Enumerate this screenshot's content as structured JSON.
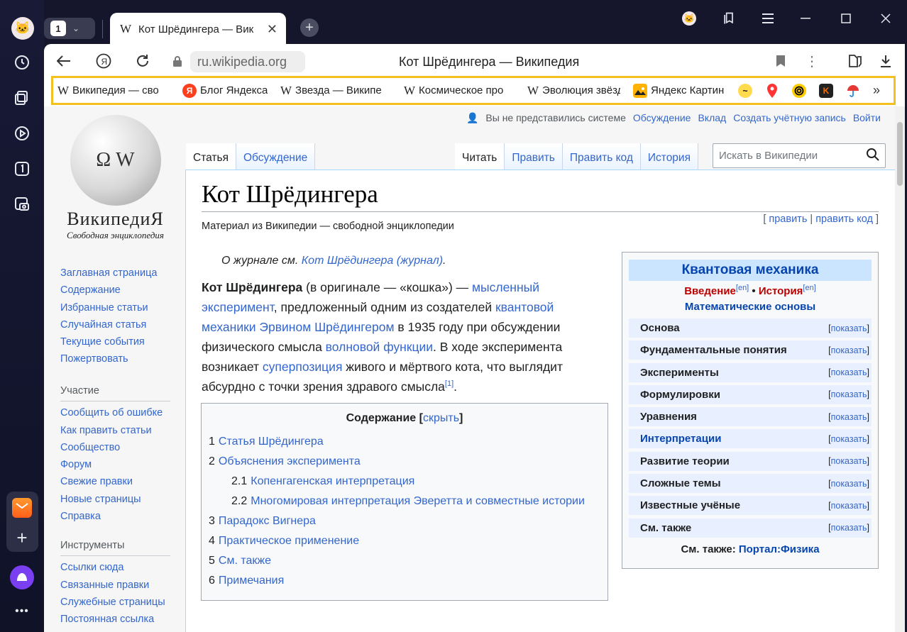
{
  "browser": {
    "tab_count": "1",
    "tab_title": "Кот Шрёдингера — Вик",
    "address": "ru.wikipedia.org",
    "page_title": "Кот Шрёдингера — Википедия",
    "bookmarks": [
      {
        "icon": "W",
        "label": "Википедия — сво"
      },
      {
        "icon": "Я",
        "label": "Блог Яндекса"
      },
      {
        "icon": "W",
        "label": "Звезда — Википе"
      },
      {
        "icon": "W",
        "label": "Космическое про"
      },
      {
        "icon": "W",
        "label": "Эволюция звёзд -"
      },
      {
        "icon": "img",
        "label": "Яндекс Картин"
      }
    ]
  },
  "wiki": {
    "personal": [
      "Вы не представились системе",
      "Обсуждение",
      "Вклад",
      "Создать учётную запись",
      "Войти"
    ],
    "logo_title": "ВикипедиЯ",
    "logo_sub": "Свободная энциклопедия",
    "nav_main": [
      "Заглавная страница",
      "Содержание",
      "Избранные статьи",
      "Случайная статья",
      "Текущие события",
      "Пожертвовать"
    ],
    "nav_part_title": "Участие",
    "nav_part": [
      "Сообщить об ошибке",
      "Как править статьи",
      "Сообщество",
      "Форум",
      "Свежие правки",
      "Новые страницы",
      "Справка"
    ],
    "nav_tools_title": "Инструменты",
    "nav_tools": [
      "Ссылки сюда",
      "Связанные правки",
      "Служебные страницы",
      "Постоянная ссылка"
    ],
    "tabs_left": [
      "Статья",
      "Обсуждение"
    ],
    "tabs_right": [
      "Читать",
      "Править",
      "Править код",
      "История"
    ],
    "search_placeholder": "Искать в Википедии",
    "title": "Кот Шрёдингера",
    "site_sub": "Материал из Википедии — свободной энциклопедии",
    "edit": "править",
    "edit_code": "править код",
    "hatnote_prefix": "О журнале см. ",
    "hatnote_link": "Кот Шрёдингера (журнал)",
    "lead": {
      "bold": "Кот Шрёдингера",
      "t1": " (в оригинале — «кошка») — ",
      "l1": "мысленный эксперимент",
      "t2": ", предложенный одним из создателей ",
      "l2": "квантовой механики",
      "t3": " ",
      "l3": "Эрвином Шрёдингером",
      "t4": " в 1935 году при обсуждении физического смысла ",
      "l4": "волновой функции",
      "t5": ". В ходе эксперимента возникает ",
      "l5": "суперпозиция",
      "t6": " живого и мёртвого кота, что выглядит абсурдно с точки зрения здравого смысла",
      "ref": "[1]",
      "t7": "."
    },
    "toc": {
      "title": "Содержание",
      "hide": "скрыть",
      "items": [
        {
          "num": "1",
          "label": "Статья Шрёдингера"
        },
        {
          "num": "2",
          "label": "Объяснения эксперимента"
        },
        {
          "num": "2.1",
          "label": "Копенгагенская интерпретация"
        },
        {
          "num": "2.2",
          "label": "Многомировая интерпретация Эверетта и совместные истории"
        },
        {
          "num": "3",
          "label": "Парадокс Вигнера"
        },
        {
          "num": "4",
          "label": "Практическое применение"
        },
        {
          "num": "5",
          "label": "См. также"
        },
        {
          "num": "6",
          "label": "Примечания"
        }
      ]
    },
    "infobox": {
      "title": "Квантовая механика",
      "intro": "Введение",
      "history": "История",
      "en": "[en]",
      "math": "Математические основы",
      "show": "показать",
      "rows": [
        "Основа",
        "Фундаментальные понятия",
        "Эксперименты",
        "Формулировки",
        "Уравнения",
        "Интерпретации",
        "Развитие теории",
        "Сложные темы",
        "Известные учёные",
        "См. также"
      ],
      "see_also": "См. также: ",
      "portal": "Портал:Физика"
    }
  }
}
